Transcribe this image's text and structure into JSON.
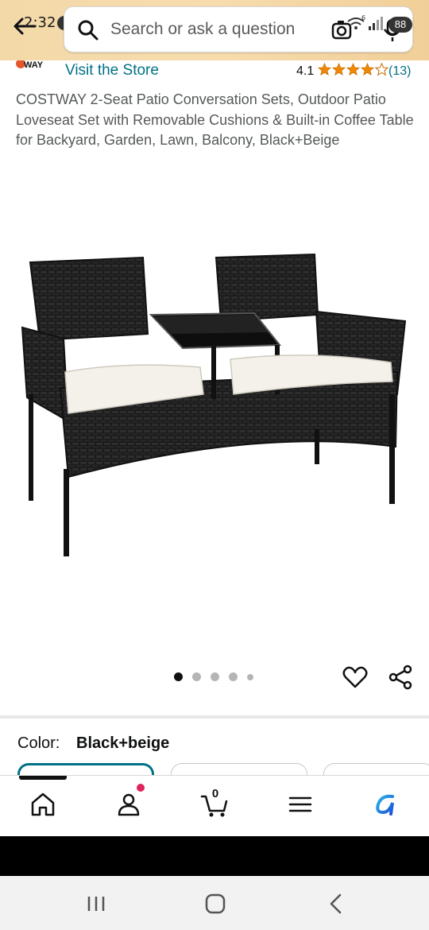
{
  "status_bar": {
    "time": "2:32",
    "network": "6",
    "battery": "88"
  },
  "search": {
    "placeholder": "Search or ask a question"
  },
  "store": {
    "logo_text": "WAY",
    "link_label": "Visit the Store",
    "rating": "4.1",
    "stars_filled": 4,
    "rating_count": "(13)"
  },
  "product": {
    "title": "COSTWAY 2-Seat Patio Conversation Sets, Outdoor Patio Loveseat Set with Removable Cushions & Built-in Coffee Table for Backyard, Garden, Lawn, Balcony, Black+Beige",
    "image_count": 5,
    "active_image": 1
  },
  "variation": {
    "color_label": "Color:",
    "color_value": "Black+beige"
  },
  "bottom_nav": {
    "items": [
      "home-icon",
      "account-icon",
      "cart-icon",
      "menu-icon",
      "rufus-icon"
    ],
    "cart_count": "0"
  },
  "colors": {
    "accent": "#007185",
    "star": "#f08804",
    "header_bg": "#f3d9a8"
  }
}
